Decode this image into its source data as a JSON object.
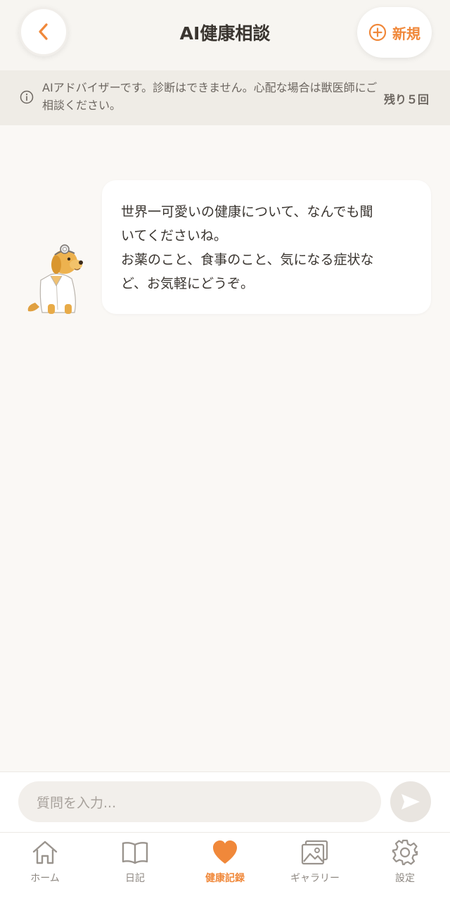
{
  "header": {
    "title": "AI健康相談",
    "new_label": "新規"
  },
  "notice": {
    "text": "AIアドバイザーです。診断はできません。心配な場合は獣医師にご相談ください。",
    "remaining": "残り５回"
  },
  "messages": [
    {
      "sender": "assistant",
      "lines": [
        "世界一可愛いの健康について、なんでも聞",
        "いてくださいね。",
        "お薬のこと、食事のこと、気になる症状な",
        "ど、お気軽にどうぞ。"
      ]
    }
  ],
  "input": {
    "placeholder": "質問を入力..."
  },
  "nav": {
    "items": [
      {
        "label": "ホーム",
        "icon": "home-icon"
      },
      {
        "label": "日記",
        "icon": "book-icon"
      },
      {
        "label": "健康記録",
        "icon": "heart-icon",
        "active": true
      },
      {
        "label": "ギャラリー",
        "icon": "gallery-icon"
      },
      {
        "label": "設定",
        "icon": "gear-icon"
      }
    ]
  },
  "colors": {
    "accent": "#f0883a",
    "background": "#faf8f5",
    "notice_bg": "#efece6",
    "text": "#3a3530",
    "muted": "#8e8882"
  }
}
